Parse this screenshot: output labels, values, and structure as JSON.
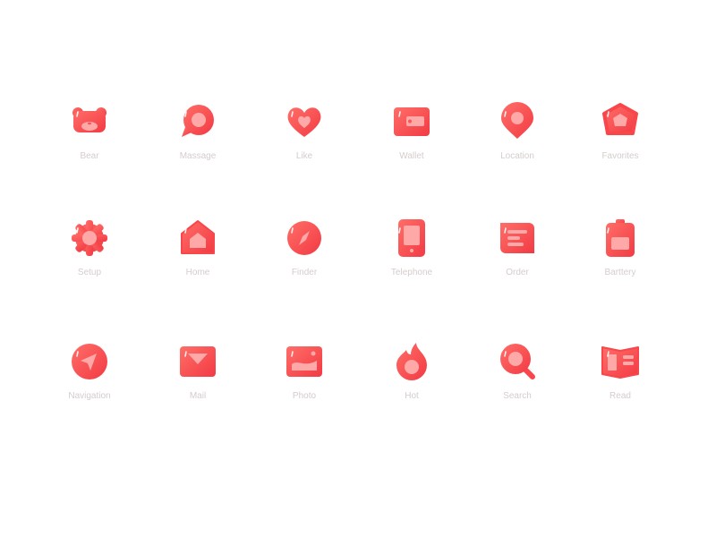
{
  "colors": {
    "primary": "#f8464a",
    "light": "#ffa8a8",
    "label": "#d6cccc"
  },
  "icons": [
    {
      "label": "Bear",
      "icon": "bear-icon"
    },
    {
      "label": "Massage",
      "icon": "message-icon"
    },
    {
      "label": "Like",
      "icon": "heart-icon"
    },
    {
      "label": "Wallet",
      "icon": "wallet-icon"
    },
    {
      "label": "Location",
      "icon": "location-icon"
    },
    {
      "label": "Favorites",
      "icon": "star-icon"
    },
    {
      "label": "Setup",
      "icon": "gear-icon"
    },
    {
      "label": "Home",
      "icon": "home-icon"
    },
    {
      "label": "Finder",
      "icon": "compass-icon"
    },
    {
      "label": "Telephone",
      "icon": "phone-icon"
    },
    {
      "label": "Order",
      "icon": "order-icon"
    },
    {
      "label": "Barttery",
      "icon": "battery-icon"
    },
    {
      "label": "Navigation",
      "icon": "navigation-icon"
    },
    {
      "label": "Mail",
      "icon": "mail-icon"
    },
    {
      "label": "Photo",
      "icon": "photo-icon"
    },
    {
      "label": "Hot",
      "icon": "fire-icon"
    },
    {
      "label": "Search",
      "icon": "search-icon"
    },
    {
      "label": "Read",
      "icon": "book-icon"
    }
  ]
}
